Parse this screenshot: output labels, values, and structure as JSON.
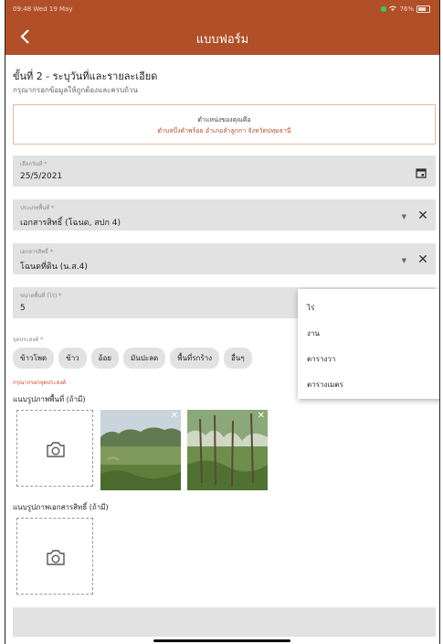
{
  "status": {
    "time": "09:48  Wed 19 May",
    "battery": "76%"
  },
  "appbar": {
    "title": "แบบฟอร์ม"
  },
  "step": {
    "title": "ขั้นที่ 2 - ระบุวันที่และรายละเอียด",
    "hint": "กรุณากรอกข้อมูลให้ถูกต้องและครบถ้วน"
  },
  "location": {
    "line1": "ตำแหน่งของคุณคือ",
    "line2": "ตำบลบึงคำพร้อย อำเภอลำลูกกา จังหวัดปทุมธานี"
  },
  "fields": {
    "date": {
      "label": "เลือกวันที่ *",
      "value": "25/5/2021"
    },
    "area_type": {
      "label": "ประเภทพื้นที่ *",
      "value": "เอกสารสิทธิ์ (โฉนด, สปก 4)"
    },
    "document": {
      "label": "เอกสารสิทธิ์ *",
      "value": "โฉนดที่ดิน (น.ส.4)"
    },
    "area_size": {
      "label": "ขนาดพื้นที่ (ไร่) *",
      "value": "5"
    }
  },
  "purpose": {
    "label": "จุดประสงค์ *",
    "chips": [
      "ข้าวโพด",
      "ข้าว",
      "อ้อย",
      "มันปะลด",
      "พื้นที่รกร้าง",
      "อื่นๆ"
    ],
    "error": "กรุณากรอกจุดประสงค์"
  },
  "photos": {
    "area_title": "แนบรูปภาพพื้นที่ (ถ้ามี)",
    "doc_title": "แนบรูปภาพเอกสารสิทธิ์ (ถ้ามี)"
  },
  "dropdown": {
    "items": [
      "ไร่",
      "งาน",
      "ตารางวา",
      "ตารางเมตร"
    ]
  }
}
